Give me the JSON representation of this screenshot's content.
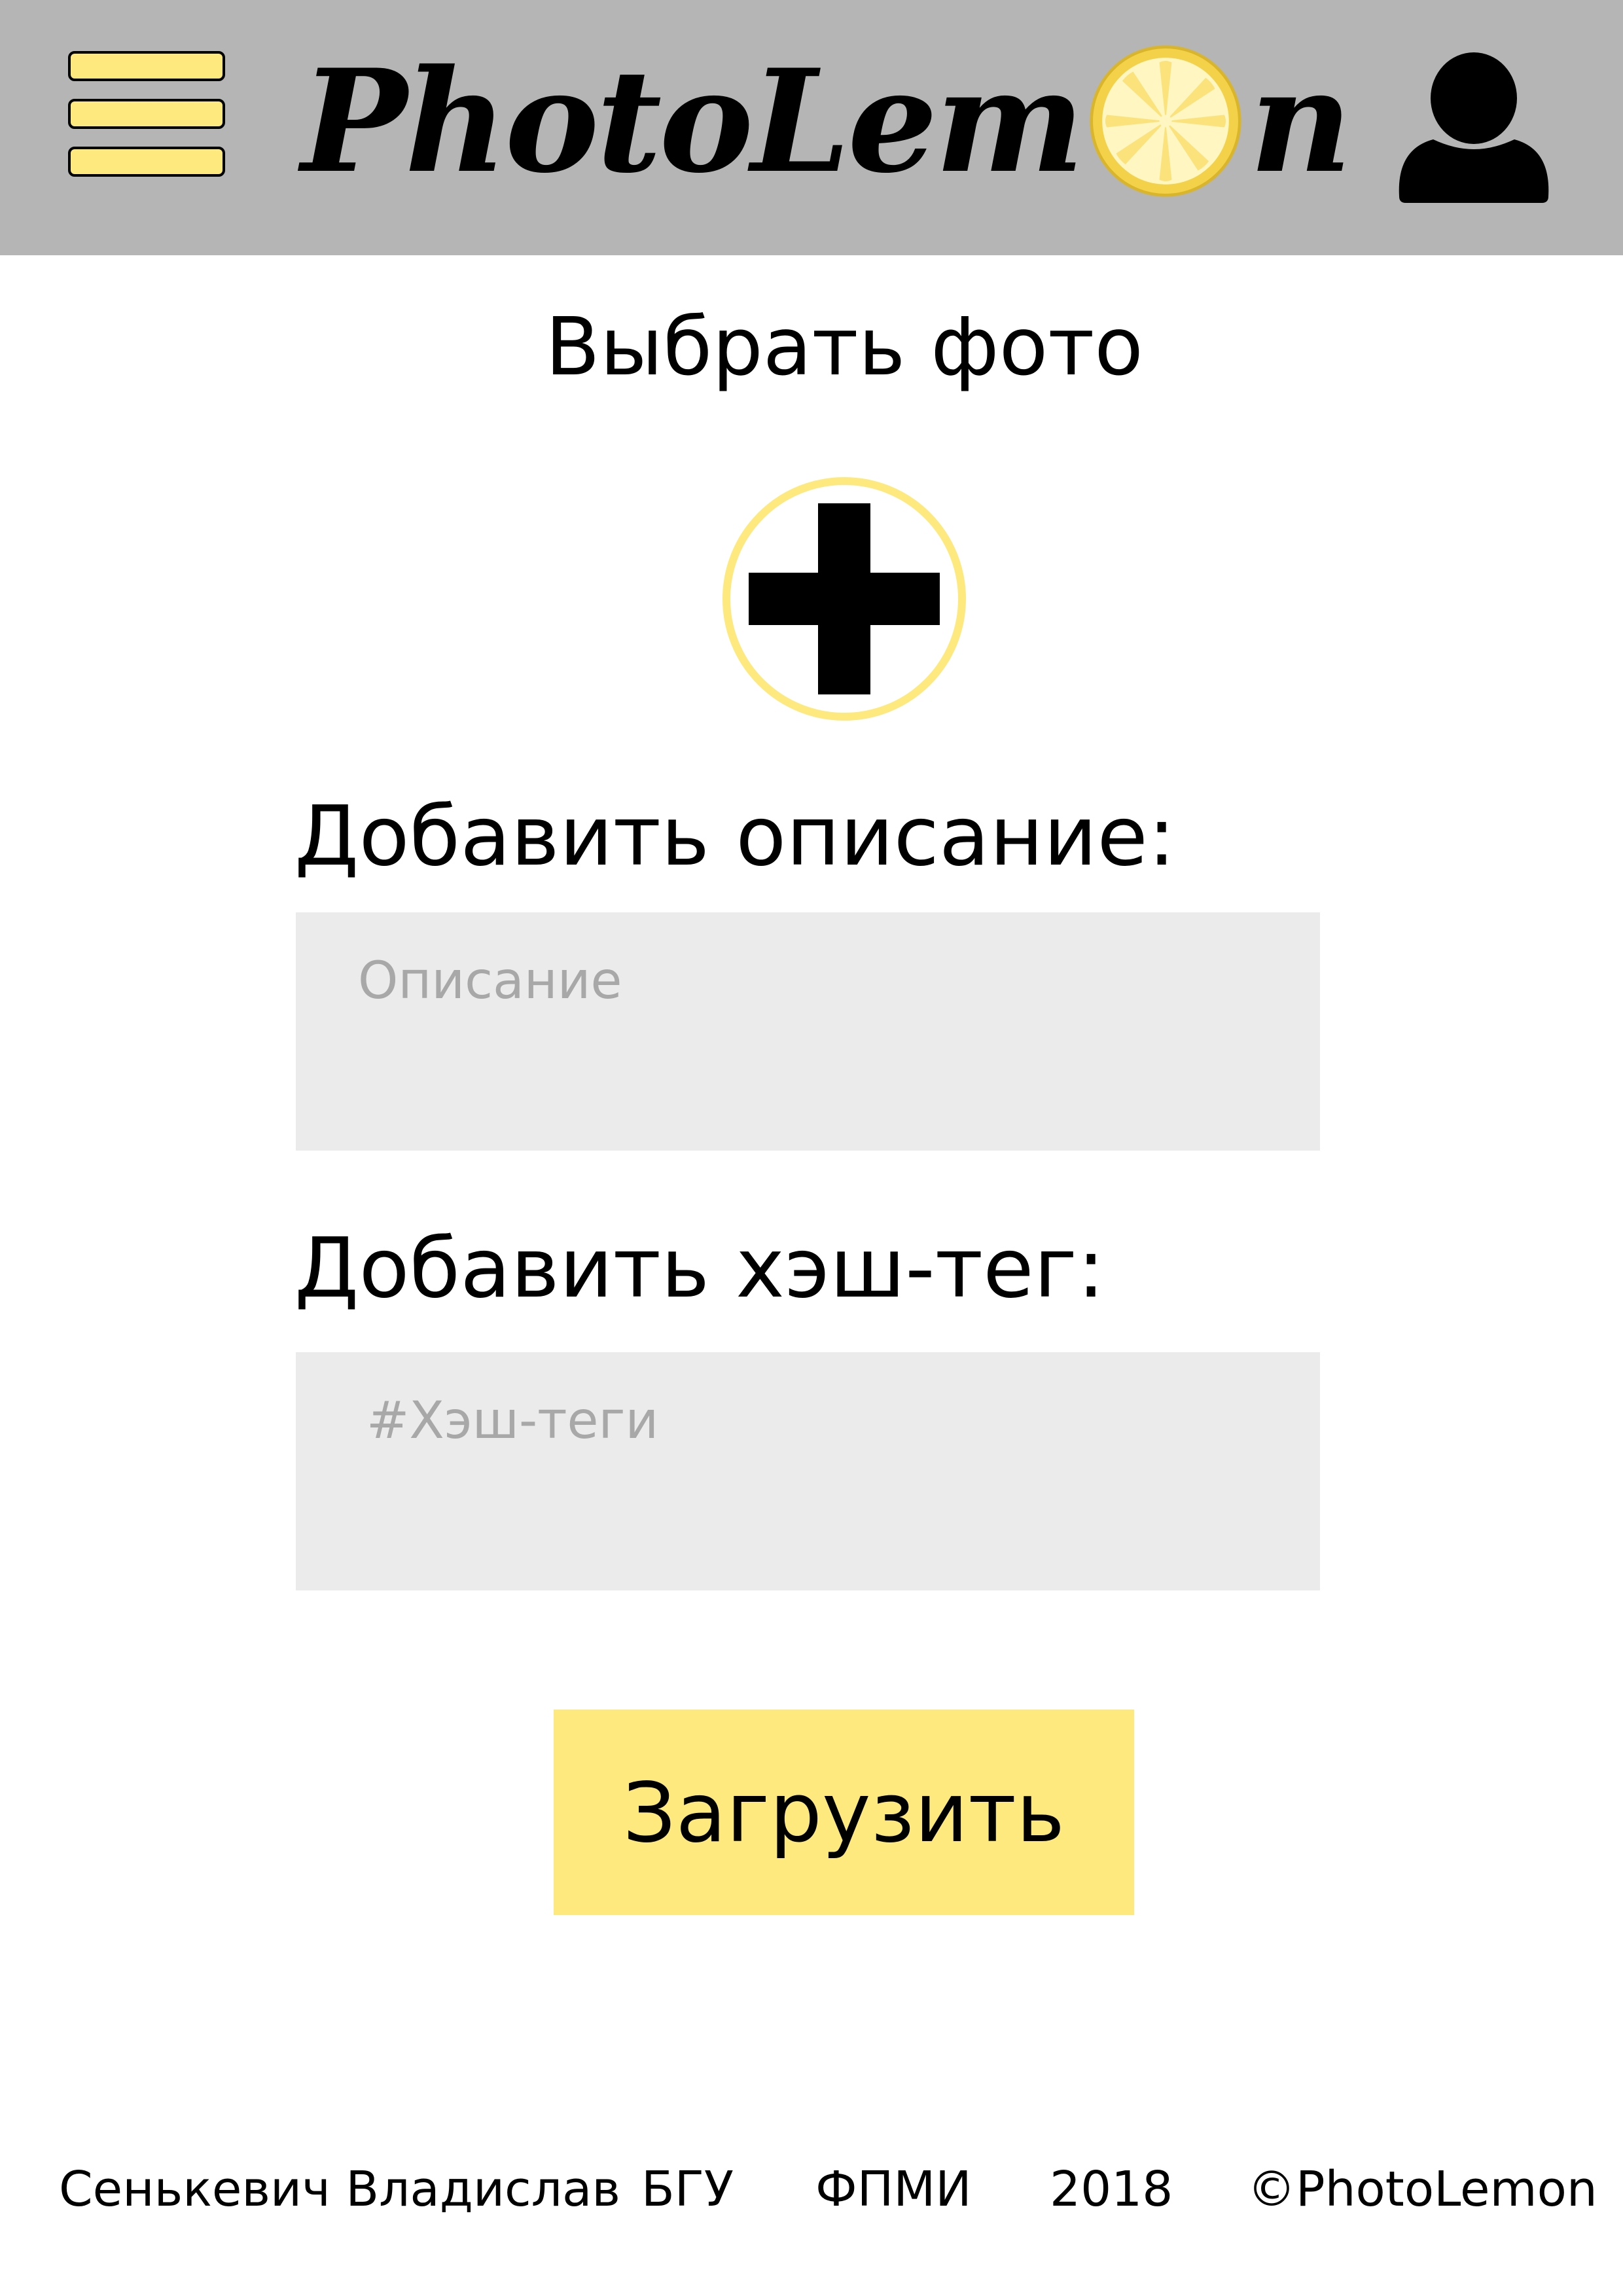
{
  "header": {
    "logo_text_before": "PhotoLem",
    "logo_text_after": "n",
    "colors": {
      "header_bg": "#b5b5b5",
      "accent_yellow": "#fde97d"
    },
    "icons": {
      "menu": "hamburger-menu-icon",
      "logo_o": "lemon-slice-icon",
      "profile": "user-icon"
    }
  },
  "main": {
    "choose_photo_title": "Выбрать фото",
    "add_photo_icon": "plus-circle-icon",
    "description_label": "Добавить описание:",
    "description_placeholder": "Описание",
    "description_value": "",
    "hashtag_label": "Добавить хэш-тег:",
    "hashtag_placeholder": "#Хэш-теги",
    "hashtag_value": "",
    "upload_button_label": "Загрузить"
  },
  "footer": {
    "author": "Сенькевич Владислав",
    "university": "БГУ",
    "faculty": "ФПМИ",
    "year": "2018",
    "copyright": "©PhotoLemon"
  }
}
